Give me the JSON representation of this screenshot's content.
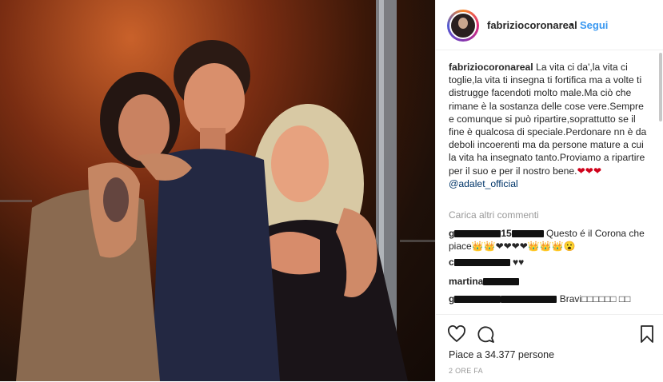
{
  "post": {
    "username": "fabriziocoronareal",
    "dot": "•",
    "follow_label": "Segui"
  },
  "caption": {
    "username": "fabriziocoronareal",
    "text": "La vita ci da',la vita ci toglie,la vita ti insegna ti fortifica ma a volte ti distrugge facendoti molto male.Ma ciò che rimane è la sostanza delle cose vere.Sempre e comunque si può ripartire,soprattutto se il fine è qualcosa di speciale.Perdonare nn è da deboli incoerenti ma da persone mature a cui la vita ha insegnato tanto.Proviamo a ripartire per il suo e per il nostro bene.",
    "hearts": "❤❤❤",
    "mention": "@adalet_official"
  },
  "comments": {
    "load_more": "Carica altri commenti",
    "items": [
      {
        "user_visible": "g",
        "user_tail": "15",
        "text": "Questo é il Corona che piace👑👑❤❤❤❤👑👑👑😮"
      },
      {
        "user_visible": "c",
        "user_tail": "",
        "text": "♥♥"
      },
      {
        "user_visible": "martina",
        "user_tail": "",
        "text": ""
      },
      {
        "user_visible": "g",
        "user_tail": "",
        "text": "Bravi□□□□□□ □□"
      }
    ]
  },
  "actions": {
    "like_icon": "heart-icon",
    "comment_icon": "comment-icon",
    "save_icon": "bookmark-icon",
    "likes_text": "Piace a 34.377 persone",
    "timestamp": "2 ORE FA"
  },
  "colors": {
    "link": "#3897f0",
    "mention": "#003569",
    "muted": "#999999",
    "heart": "#d0021b"
  }
}
